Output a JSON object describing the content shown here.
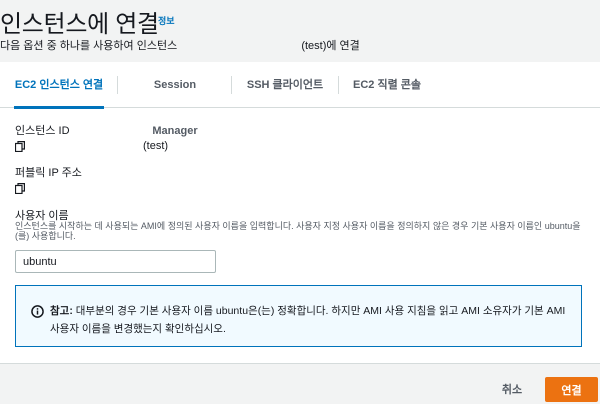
{
  "header": {
    "title": "인스턴스에 연결",
    "info_link": "정보",
    "subtitle_before": "다음 옵션 중 하나를 사용하여 인스턴스",
    "subtitle_after": "(test)에 연결"
  },
  "tabs": [
    {
      "label": "EC2 인스턴스 연결",
      "active": true
    },
    {
      "label": "Session Manager",
      "active": false
    },
    {
      "label": "SSH 클라이언트",
      "active": false
    },
    {
      "label": "EC2 직렬 콘솔",
      "active": false
    }
  ],
  "instance_id": {
    "label": "인스턴스 ID",
    "value": "(test)",
    "icon": "copy-icon"
  },
  "public_ip": {
    "label": "퍼블릭 IP 주소",
    "icon": "copy-icon"
  },
  "username": {
    "label": "사용자 이름",
    "description": "인스턴스를 시작하는 데 사용되는 AMI에 정의된 사용자 이름을 입력합니다. 사용자 지정 사용자 이름을 정의하지 않은 경우 기본 사용자 이름인 ubuntu을(를) 사용합니다.",
    "value": "ubuntu"
  },
  "alert": {
    "icon": "info-icon",
    "bold": "참고:",
    "text": "대부분의 경우 기본 사용자 이름 ubuntu은(는) 정확합니다. 하지만 AMI 사용 지침을 읽고 AMI 소유자가 기본 AMI 사용자 이름을 변경했는지 확인하십시오."
  },
  "footer": {
    "cancel_label": "취소",
    "connect_label": "연결"
  },
  "colors": {
    "accent": "#0073bb",
    "primary_button": "#ec7211",
    "alert_bg": "#f1faff"
  }
}
